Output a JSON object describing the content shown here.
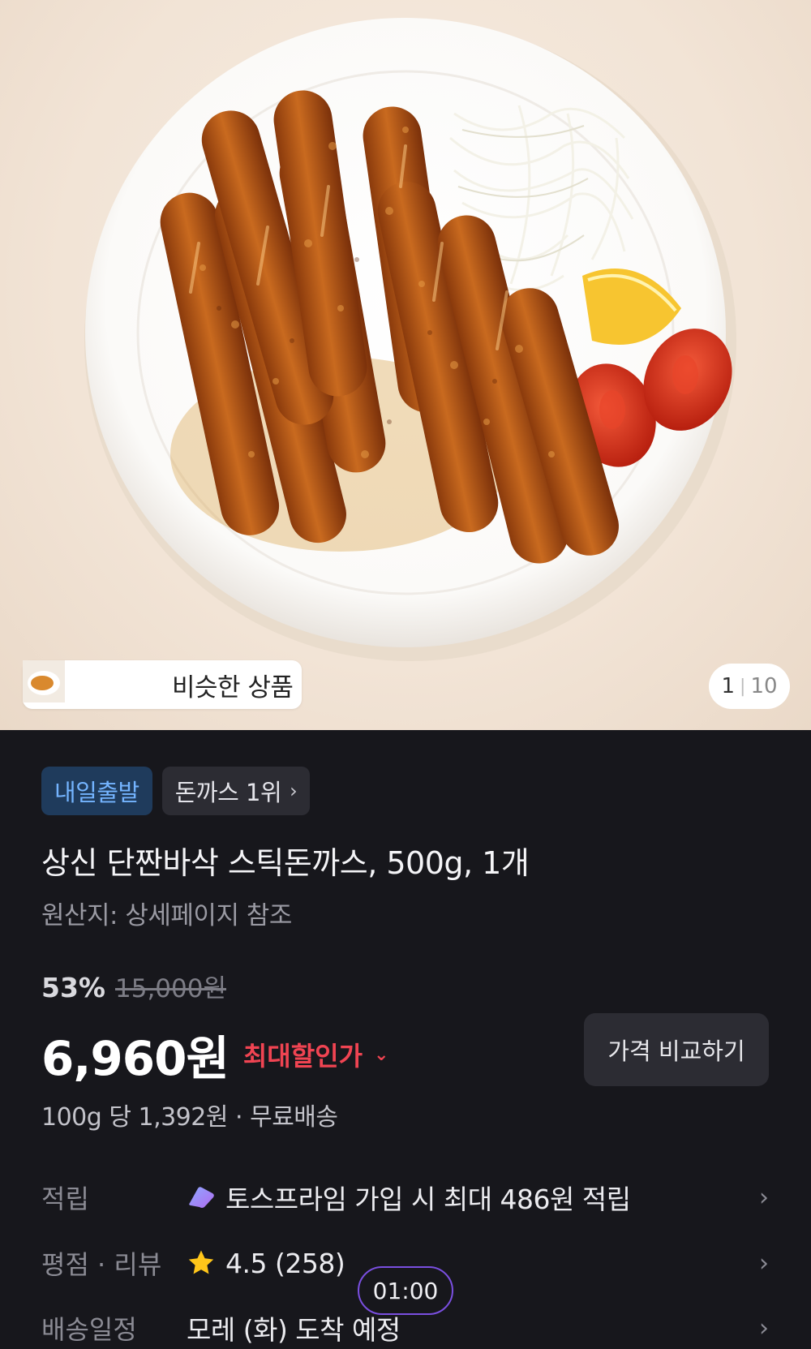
{
  "gallery": {
    "similar_label": "비슷한 상품",
    "current": "1",
    "total": "10"
  },
  "product": {
    "badges": {
      "delivery": "내일출발",
      "ranking": "돈까스 1위"
    },
    "title": "상신 단짠바삭 스틱돈까스, 500g, 1개",
    "origin": "원산지: 상세페이지 참조",
    "discount_percent": "53%",
    "original_price": "15,000원",
    "price": "6,960원",
    "max_discount_label": "최대할인가",
    "compare_button": "가격 비교하기",
    "unit_price": "100g 당 1,392원",
    "dot": "·",
    "shipping": "무료배송"
  },
  "details": {
    "reward_label": "적립",
    "reward_value": "토스프라임 가입 시 최대 486원 적립",
    "rating_label": "평점 · 리뷰",
    "rating_value": "4.5 (258)",
    "delivery_label": "배송일정",
    "delivery_value": "모레 (화) 도착 예정"
  },
  "timer": "01:00",
  "colors": {
    "background": "#17171c",
    "accent_blue": "#74b4ff",
    "discount_red": "#f04452",
    "star": "#ffc61a",
    "timer_border": "#7a4fe0"
  },
  "icons": {
    "ranking_chevron": "chevron-right-icon",
    "discount_chevron": "chevron-down-icon",
    "prime": "toss-prime-icon",
    "rating": "star-icon",
    "row_chevron": "chevron-right-icon"
  }
}
